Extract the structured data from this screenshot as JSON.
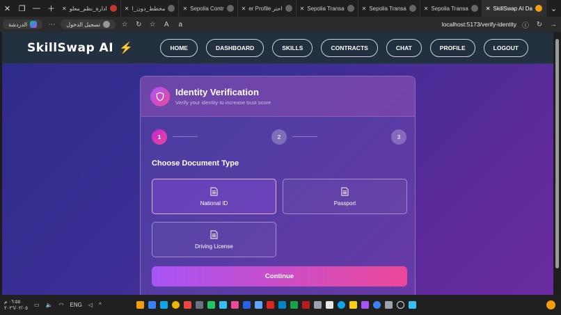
{
  "browser": {
    "tabs": [
      {
        "label": "ادارة_نظم_معلو"
      },
      {
        "label": "مخطط_دون_ا"
      },
      {
        "label": "Sepolia Contr"
      },
      {
        "label": "er Profile احتر"
      },
      {
        "label": "Sepolia Transa"
      },
      {
        "label": "Sepolia Transa"
      },
      {
        "label": "Sepolia Transa"
      },
      {
        "label": "SkillSwap AI Da"
      }
    ],
    "chat_label": "الدردشة",
    "signin_label": "تسجيل الدخول",
    "url": "localhost:5173/verify-identity"
  },
  "nav": {
    "logo": "SkillSwap AI",
    "links": [
      "HOME",
      "DASHBOARD",
      "SKILLS",
      "CONTRACTS",
      "CHAT",
      "PROFILE",
      "LOGOUT"
    ]
  },
  "card": {
    "title": "Identity Verification",
    "subtitle": "Verify your identity to increase trust score",
    "steps": [
      "1",
      "2",
      "3"
    ],
    "active_step": 1,
    "section_title": "Choose Document Type",
    "options": [
      "National ID",
      "Passport",
      "Driving License"
    ],
    "selected_option": "National ID",
    "continue_label": "Continue"
  },
  "taskbar": {
    "time": "٠٦:٥٥ م",
    "date": "٢٠٢٦/٠٢/٠٥",
    "lang": "ENG"
  },
  "colors": {
    "accent_start": "#a855f7",
    "accent_end": "#ec4899",
    "nav_bg": "#23303f"
  }
}
